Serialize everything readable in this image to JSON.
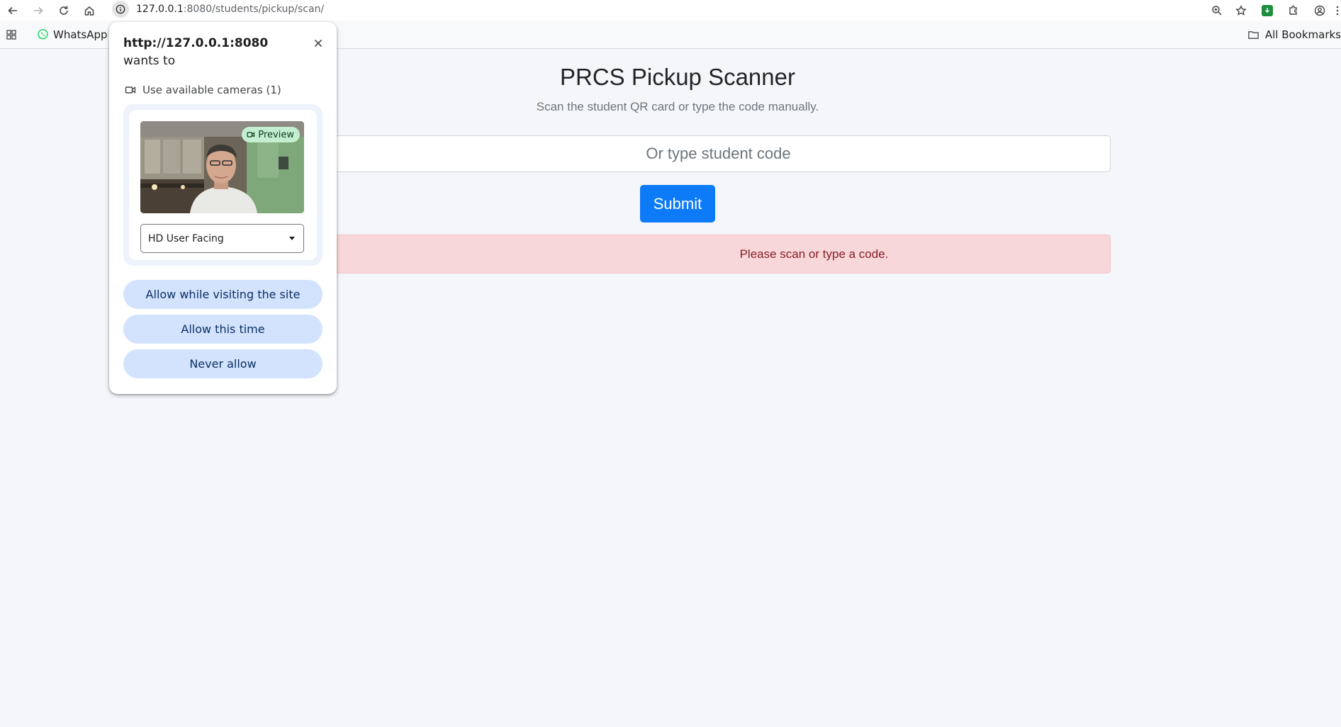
{
  "browser": {
    "url_host": "127.0.0.1",
    "url_rest": ":8080/students/pickup/scan/",
    "bookmarks": [
      {
        "label": "WhatsApp"
      }
    ],
    "all_bookmarks_label": "All Bookmarks"
  },
  "page": {
    "title": "PRCS Pickup Scanner",
    "subtitle": "Scan the student QR card or type the code manually.",
    "code_placeholder": "Or type student code",
    "submit_label": "Submit",
    "alert_text": "Please scan or type a code."
  },
  "permission_popup": {
    "origin": "http://127.0.0.1:8080",
    "wants_to": "wants to",
    "permission_label": "Use available cameras (1)",
    "preview_badge": "Preview",
    "camera_selected": "HD User Facing",
    "buttons": {
      "allow_while_visiting": "Allow while visiting the site",
      "allow_this_time": "Allow this time",
      "never_allow": "Never allow"
    }
  },
  "colors": {
    "primary_button": "#0d7bf7",
    "alert_bg": "#f8d7da",
    "alert_text": "#842029",
    "pill_bg": "#d3e3fd",
    "badge_bg": "#c4eed0"
  }
}
